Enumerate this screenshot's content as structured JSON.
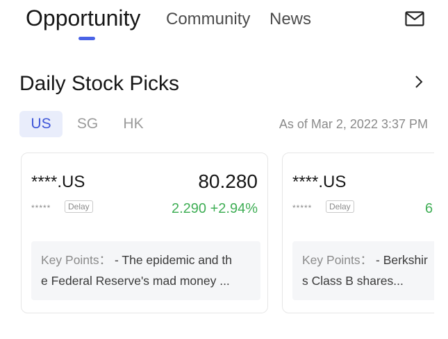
{
  "nav": {
    "tabs": [
      {
        "label": "Opportunity"
      },
      {
        "label": "Community"
      },
      {
        "label": "News"
      }
    ],
    "mail_icon": "envelope-icon"
  },
  "section": {
    "title": "Daily Stock Picks",
    "more_icon": "chevron-right-icon"
  },
  "markets": {
    "tabs": [
      {
        "label": "US"
      },
      {
        "label": "SG"
      },
      {
        "label": "HK"
      }
    ],
    "as_of": "As of Mar 2, 2022 3:37 PM"
  },
  "cards": [
    {
      "ticker": "****.US",
      "price": "80.280",
      "name_masked": "*****",
      "delay_badge": "Delay",
      "change": "2.290 +2.94%",
      "key_points_label": "Key Points：",
      "key_points_line1": " - The epidemic and th",
      "key_points_line2": "e Federal Reserve's mad money ..."
    },
    {
      "ticker": "****.US",
      "price": "",
      "name_masked": "*****",
      "delay_badge": "Delay",
      "change": "6.",
      "key_points_label": "Key Points：",
      "key_points_line1": " - Berkshir",
      "key_points_line2": "s Class B shares..."
    }
  ],
  "colors": {
    "accent": "#4a63e6",
    "active_tab_bg": "#e9edfb",
    "positive": "#3fae55"
  }
}
